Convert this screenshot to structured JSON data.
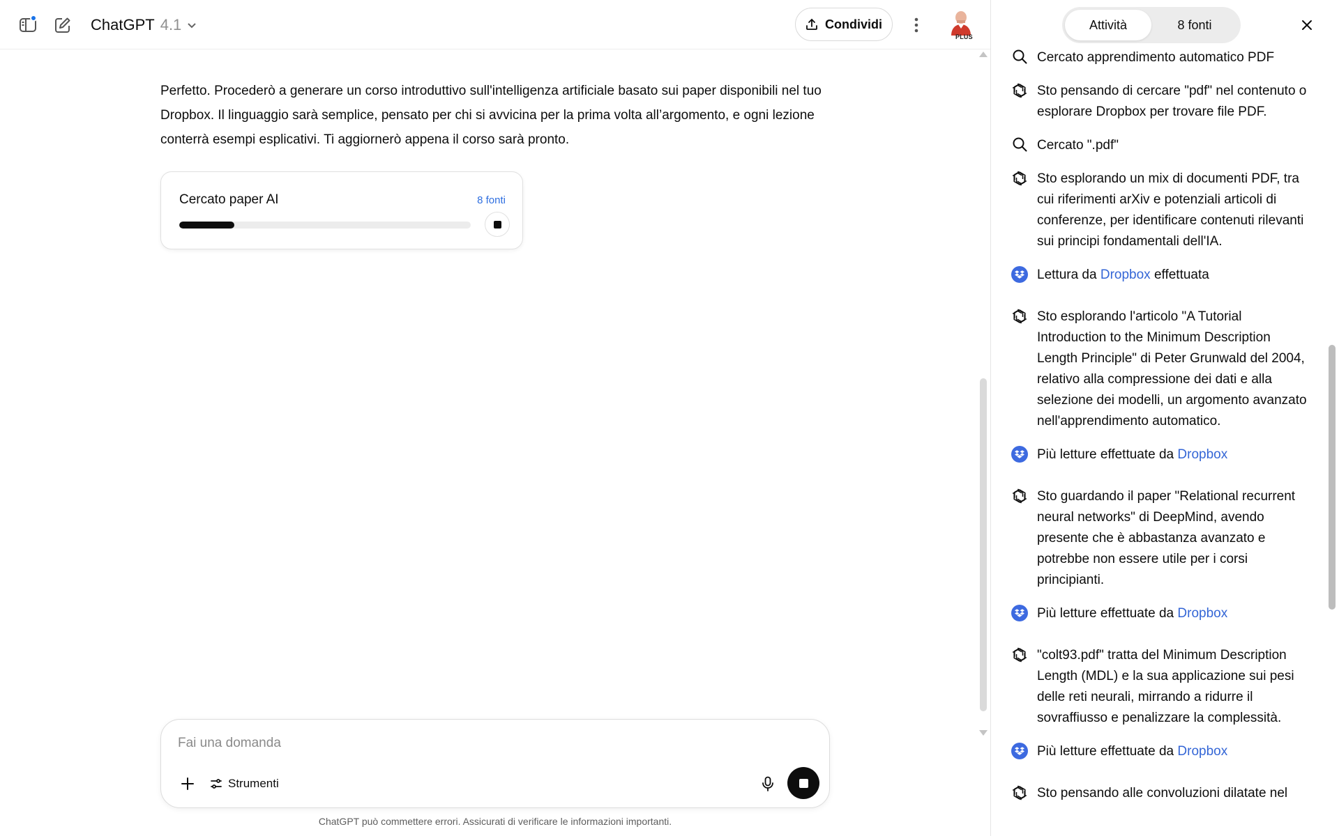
{
  "header": {
    "app_name": "ChatGPT",
    "model_version": "4.1",
    "share_label": "Condividi",
    "plan_badge": "PLUS"
  },
  "conversation": {
    "assistant_message": "Perfetto. Procederò a generare un corso introduttivo sull'intelligenza artificiale basato sui paper disponibili nel tuo Dropbox. Il linguaggio sarà semplice, pensato per chi si avvicina per la prima volta all’argomento, e ogni lezione conterrà esempi esplicativi. Ti aggiornerò appena il corso sarà pronto.",
    "search_card": {
      "title": "Cercato paper AI",
      "sources_label": "8 fonti",
      "progress_fraction": 0.19
    }
  },
  "composer": {
    "placeholder": "Fai una domanda",
    "tools_label": "Strumenti",
    "disclaimer": "ChatGPT può commettere errori. Assicurati di verificare le informazioni importanti."
  },
  "activity_panel": {
    "tabs": [
      {
        "label": "Attività",
        "active": true
      },
      {
        "label": "8 fonti",
        "active": false
      }
    ],
    "entries": [
      {
        "icon": "search-icon",
        "text": "Cercato apprendimento automatico PDF"
      },
      {
        "icon": "openai-logo-icon",
        "text": "Sto pensando di cercare \"pdf\" nel contenuto o esplorare Dropbox per trovare file PDF."
      },
      {
        "icon": "search-icon",
        "text": "Cercato \".pdf\""
      },
      {
        "icon": "openai-logo-icon",
        "text": "Sto esplorando un mix di documenti PDF, tra cui riferimenti arXiv e potenziali articoli di conferenze, per identificare contenuti rilevanti sui principi fondamentali dell'IA."
      },
      {
        "icon": "dropbox-icon",
        "prefix": "Lettura da ",
        "link": "Dropbox",
        "suffix": " effettuata"
      },
      {
        "icon": "openai-logo-icon",
        "text": "Sto esplorando l'articolo \"A Tutorial Introduction to the Minimum Description Length Principle\" di Peter Grunwald del 2004, relativo alla compressione dei dati e alla selezione dei modelli, un argomento avanzato nell'apprendimento automatico."
      },
      {
        "icon": "dropbox-icon",
        "prefix": "Più letture effettuate da ",
        "link": "Dropbox",
        "suffix": ""
      },
      {
        "icon": "openai-logo-icon",
        "text": "Sto guardando il paper \"Relational recurrent neural networks\" di DeepMind, avendo presente che è abbastanza avanzato e potrebbe non essere utile per i corsi principianti."
      },
      {
        "icon": "dropbox-icon",
        "prefix": "Più letture effettuate da ",
        "link": "Dropbox",
        "suffix": ""
      },
      {
        "icon": "openai-logo-icon",
        "text": "\"colt93.pdf\" tratta del Minimum Description Length (MDL) e la sua applicazione sui pesi delle reti neurali, mirrando a ridurre il sovraffiusso e penalizzare la complessità."
      },
      {
        "icon": "dropbox-icon",
        "prefix": "Più letture effettuate da ",
        "link": "Dropbox",
        "suffix": ""
      },
      {
        "icon": "openai-logo-icon",
        "text": "Sto pensando alle convoluzioni dilatate nel"
      }
    ]
  },
  "colors": {
    "link": "#3466d6",
    "dropbox": "#3d6ae0",
    "notification_dot": "#1a73e8"
  }
}
